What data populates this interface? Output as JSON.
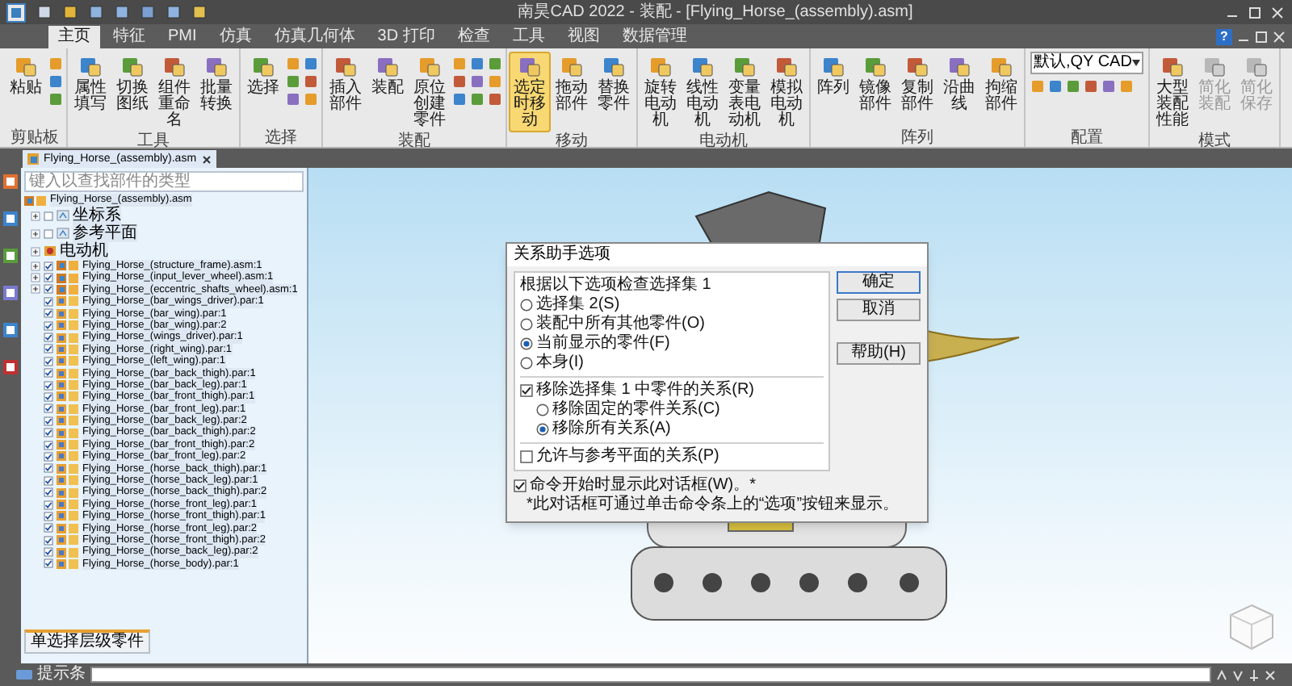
{
  "window": {
    "title": "南昊CAD 2022 - 装配 - [Flying_Horse_(assembly).asm]"
  },
  "tabs": [
    {
      "label": "主页",
      "selected": true
    },
    {
      "label": "特征",
      "selected": false
    },
    {
      "label": "PMI",
      "selected": false
    },
    {
      "label": "仿真",
      "selected": false
    },
    {
      "label": "仿真几何体",
      "selected": false
    },
    {
      "label": "3D 打印",
      "selected": false
    },
    {
      "label": "检查",
      "selected": false
    },
    {
      "label": "工具",
      "selected": false
    },
    {
      "label": "视图",
      "selected": false
    },
    {
      "label": "数据管理",
      "selected": false
    }
  ],
  "ribbon": [
    {
      "label": "剪贴板",
      "buttons": [
        {
          "label": "粘贴"
        }
      ]
    },
    {
      "label": "工具",
      "buttons": [
        {
          "label": "属性填写"
        },
        {
          "label": "切换图纸"
        },
        {
          "label": "组件重命名"
        },
        {
          "label": "批量转换"
        }
      ]
    },
    {
      "label": "选择",
      "buttons": [
        {
          "label": "选择"
        }
      ]
    },
    {
      "label": "装配",
      "buttons": [
        {
          "label": "插入部件"
        },
        {
          "label": "装配"
        },
        {
          "label": "原位创建零件"
        }
      ]
    },
    {
      "label": "移动",
      "buttons": [
        {
          "label": "选定时移动",
          "selected": true
        },
        {
          "label": "拖动部件",
          "selected": false
        },
        {
          "label": "替换零件",
          "selected": false
        }
      ]
    },
    {
      "label": "电动机",
      "buttons": [
        {
          "label": "旋转电动机"
        },
        {
          "label": "线性电动机"
        },
        {
          "label": "变量表电动机"
        },
        {
          "label": "模拟电动机"
        }
      ]
    },
    {
      "label": "阵列",
      "buttons": [
        {
          "label": "阵列"
        },
        {
          "label": "镜像部件"
        },
        {
          "label": "复制部件"
        },
        {
          "label": "沿曲线"
        },
        {
          "label": "拘缩部件"
        }
      ]
    },
    {
      "label": "配置",
      "dropdown": "默认,QY CAD"
    },
    {
      "label": "模式",
      "buttons": [
        {
          "label": "大型装配性能",
          "disabled": false
        },
        {
          "label": "简化装配",
          "disabled": true
        },
        {
          "label": "简化保存",
          "disabled": true
        }
      ]
    }
  ],
  "help_button": "?",
  "document_tab": "Flying_Horse_(assembly).asm",
  "tree": {
    "search": {
      "placeholder": "键入以查找部件的类型"
    },
    "root": {
      "label": "Flying_Horse_(assembly).asm",
      "children": [
        {
          "label": "坐标系",
          "kind": "folder",
          "checked": false,
          "expanded": false
        },
        {
          "label": "参考平面",
          "kind": "folder",
          "checked": false,
          "expanded": false
        },
        {
          "label": "电动机",
          "kind": "group",
          "expanded": false
        },
        {
          "label": "Flying_Horse_(structure_frame).asm:1",
          "kind": "assembly",
          "checked": true,
          "expanded": false
        },
        {
          "label": "Flying_Horse_(input_lever_wheel).asm:1",
          "kind": "assembly",
          "checked": true,
          "expanded": false
        },
        {
          "label": "Flying_Horse_(eccentric_shafts_wheel).asm:1",
          "kind": "assembly",
          "checked": true,
          "expanded": false
        },
        {
          "label": "Flying_Horse_(bar_wings_driver).par:1",
          "kind": "part",
          "checked": true
        },
        {
          "label": "Flying_Horse_(bar_wing).par:1",
          "kind": "part",
          "checked": true
        },
        {
          "label": "Flying_Horse_(bar_wing).par:2",
          "kind": "part",
          "checked": true
        },
        {
          "label": "Flying_Horse_(wings_driver).par:1",
          "kind": "part",
          "checked": true
        },
        {
          "label": "Flying_Horse_(right_wing).par:1",
          "kind": "part",
          "checked": true
        },
        {
          "label": "Flying_Horse_(left_wing).par:1",
          "kind": "part",
          "checked": true
        },
        {
          "label": "Flying_Horse_(bar_back_thigh).par:1",
          "kind": "part",
          "checked": true
        },
        {
          "label": "Flying_Horse_(bar_back_leg).par:1",
          "kind": "part",
          "checked": true
        },
        {
          "label": "Flying_Horse_(bar_front_thigh).par:1",
          "kind": "part",
          "checked": true
        },
        {
          "label": "Flying_Horse_(bar_front_leg).par:1",
          "kind": "part",
          "checked": true
        },
        {
          "label": "Flying_Horse_(bar_back_leg).par:2",
          "kind": "part",
          "checked": true
        },
        {
          "label": "Flying_Horse_(bar_back_thigh).par:2",
          "kind": "part",
          "checked": true
        },
        {
          "label": "Flying_Horse_(bar_front_thigh).par:2",
          "kind": "part",
          "checked": true
        },
        {
          "label": "Flying_Horse_(bar_front_leg).par:2",
          "kind": "part",
          "checked": true
        },
        {
          "label": "Flying_Horse_(horse_back_thigh).par:1",
          "kind": "part",
          "checked": true
        },
        {
          "label": "Flying_Horse_(horse_back_leg).par:1",
          "kind": "part",
          "checked": true
        },
        {
          "label": "Flying_Horse_(horse_back_thigh).par:2",
          "kind": "part",
          "checked": true
        },
        {
          "label": "Flying_Horse_(horse_front_leg).par:1",
          "kind": "part",
          "checked": true
        },
        {
          "label": "Flying_Horse_(horse_front_thigh).par:1",
          "kind": "part",
          "checked": true
        },
        {
          "label": "Flying_Horse_(horse_front_leg).par:2",
          "kind": "part",
          "checked": true
        },
        {
          "label": "Flying_Horse_(horse_front_thigh).par:2",
          "kind": "part",
          "checked": true
        },
        {
          "label": "Flying_Horse_(horse_back_leg).par:2",
          "kind": "part",
          "checked": true
        },
        {
          "label": "Flying_Horse_(horse_body).par:1",
          "kind": "part",
          "checked": true
        }
      ]
    },
    "bottom_button": "单选择层级零件"
  },
  "dialog": {
    "title": "关系助手选项",
    "group_label": "根据以下选项检查选择集 1",
    "options": [
      {
        "label": "选择集 2(S)",
        "selected": false
      },
      {
        "label": "装配中所有其他零件(O)",
        "selected": false
      },
      {
        "label": "当前显示的零件(F)",
        "selected": true
      },
      {
        "label": "本身(I)",
        "selected": false
      }
    ],
    "remove": {
      "label": "移除选择集 1 中零件的关系(R)",
      "checked": true,
      "options": [
        {
          "label": "移除固定的零件关系(C)",
          "selected": false
        },
        {
          "label": "移除所有关系(A)",
          "selected": true
        }
      ]
    },
    "allow_planes": {
      "label": "允许与参考平面的关系(P)",
      "checked": false
    },
    "show_on_start": {
      "label": "命令开始时显示此对话框(W)。*",
      "checked": true
    },
    "note": "*此对话框可通过单击命令条上的“选项”按钮来显示。",
    "buttons": [
      "确定",
      "取消",
      "帮助(H)"
    ]
  },
  "command_bar": {
    "label": "提示条"
  }
}
